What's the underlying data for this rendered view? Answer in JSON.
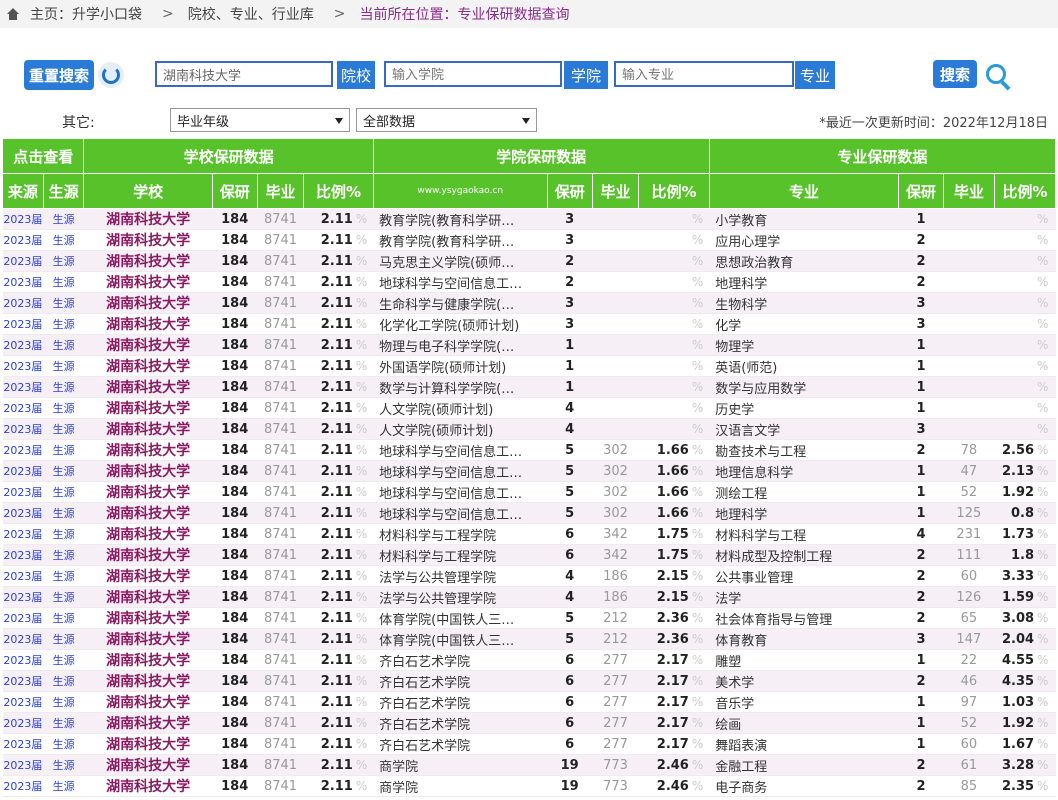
{
  "breadcrumb": {
    "home": "主页：升学小口袋",
    "level2": "院校、专业、行业库",
    "current": "当前所在位置：专业保研数据查询"
  },
  "search": {
    "reset_label": "重置搜索",
    "school_value": "湖南科技大学",
    "school_label": "院校",
    "college_placeholder": "输入学院",
    "college_label": "学院",
    "major_placeholder": "输入专业",
    "major_label": "专业",
    "search_label": "搜索"
  },
  "filters": {
    "label": "其它:",
    "year_select": "毕业年级",
    "data_select": "全部数据",
    "updated": "*最近一次更新时间：2022年12月18日"
  },
  "table": {
    "group_headers": {
      "click": "点击查看",
      "school": "学校保研数据",
      "college": "学院保研数据",
      "major": "专业保研数据"
    },
    "headers": {
      "source": "来源",
      "origin": "生源",
      "school": "学校",
      "baoyan": "保研",
      "grad": "毕业",
      "ratio": "比例%",
      "watermark": "www.ysygaokao.cn",
      "c_baoyan": "保研",
      "c_grad": "毕业",
      "c_ratio": "比例%",
      "major": "专业",
      "m_baoyan": "保研",
      "m_grad": "毕业",
      "m_ratio": "比例%"
    },
    "pct_sign": "%",
    "rows": [
      {
        "src": "2023届",
        "gen": "生源",
        "school": "湖南科技大学",
        "sb": "184",
        "sg": "8741",
        "sr": "2.11",
        "college": "教育学院(教育科学研…",
        "cb": "3",
        "cg": "",
        "cr": "",
        "major": "小学教育",
        "mb": "1",
        "mg": "",
        "mr": ""
      },
      {
        "src": "2023届",
        "gen": "生源",
        "school": "湖南科技大学",
        "sb": "184",
        "sg": "8741",
        "sr": "2.11",
        "college": "教育学院(教育科学研…",
        "cb": "3",
        "cg": "",
        "cr": "",
        "major": "应用心理学",
        "mb": "2",
        "mg": "",
        "mr": ""
      },
      {
        "src": "2023届",
        "gen": "生源",
        "school": "湖南科技大学",
        "sb": "184",
        "sg": "8741",
        "sr": "2.11",
        "college": "马克思主义学院(硕师…",
        "cb": "2",
        "cg": "",
        "cr": "",
        "major": "思想政治教育",
        "mb": "2",
        "mg": "",
        "mr": ""
      },
      {
        "src": "2023届",
        "gen": "生源",
        "school": "湖南科技大学",
        "sb": "184",
        "sg": "8741",
        "sr": "2.11",
        "college": "地球科学与空间信息工…",
        "cb": "2",
        "cg": "",
        "cr": "",
        "major": "地理科学",
        "mb": "2",
        "mg": "",
        "mr": ""
      },
      {
        "src": "2023届",
        "gen": "生源",
        "school": "湖南科技大学",
        "sb": "184",
        "sg": "8741",
        "sr": "2.11",
        "college": "生命科学与健康学院(…",
        "cb": "3",
        "cg": "",
        "cr": "",
        "major": "生物科学",
        "mb": "3",
        "mg": "",
        "mr": ""
      },
      {
        "src": "2023届",
        "gen": "生源",
        "school": "湖南科技大学",
        "sb": "184",
        "sg": "8741",
        "sr": "2.11",
        "college": "化学化工学院(硕师计划)",
        "cb": "3",
        "cg": "",
        "cr": "",
        "major": "化学",
        "mb": "3",
        "mg": "",
        "mr": ""
      },
      {
        "src": "2023届",
        "gen": "生源",
        "school": "湖南科技大学",
        "sb": "184",
        "sg": "8741",
        "sr": "2.11",
        "college": "物理与电子科学学院(…",
        "cb": "1",
        "cg": "",
        "cr": "",
        "major": "物理学",
        "mb": "1",
        "mg": "",
        "mr": ""
      },
      {
        "src": "2023届",
        "gen": "生源",
        "school": "湖南科技大学",
        "sb": "184",
        "sg": "8741",
        "sr": "2.11",
        "college": "外国语学院(硕师计划)",
        "cb": "1",
        "cg": "",
        "cr": "",
        "major": "英语(师范)",
        "mb": "1",
        "mg": "",
        "mr": ""
      },
      {
        "src": "2023届",
        "gen": "生源",
        "school": "湖南科技大学",
        "sb": "184",
        "sg": "8741",
        "sr": "2.11",
        "college": "数学与计算科学学院(…",
        "cb": "1",
        "cg": "",
        "cr": "",
        "major": "数学与应用数学",
        "mb": "1",
        "mg": "",
        "mr": ""
      },
      {
        "src": "2023届",
        "gen": "生源",
        "school": "湖南科技大学",
        "sb": "184",
        "sg": "8741",
        "sr": "2.11",
        "college": "人文学院(硕师计划)",
        "cb": "4",
        "cg": "",
        "cr": "",
        "major": "历史学",
        "mb": "1",
        "mg": "",
        "mr": ""
      },
      {
        "src": "2023届",
        "gen": "生源",
        "school": "湖南科技大学",
        "sb": "184",
        "sg": "8741",
        "sr": "2.11",
        "college": "人文学院(硕师计划)",
        "cb": "4",
        "cg": "",
        "cr": "",
        "major": "汉语言文学",
        "mb": "3",
        "mg": "",
        "mr": ""
      },
      {
        "src": "2023届",
        "gen": "生源",
        "school": "湖南科技大学",
        "sb": "184",
        "sg": "8741",
        "sr": "2.11",
        "college": "地球科学与空间信息工…",
        "cb": "5",
        "cg": "302",
        "cr": "1.66",
        "major": "勘查技术与工程",
        "mb": "2",
        "mg": "78",
        "mr": "2.56"
      },
      {
        "src": "2023届",
        "gen": "生源",
        "school": "湖南科技大学",
        "sb": "184",
        "sg": "8741",
        "sr": "2.11",
        "college": "地球科学与空间信息工…",
        "cb": "5",
        "cg": "302",
        "cr": "1.66",
        "major": "地理信息科学",
        "mb": "1",
        "mg": "47",
        "mr": "2.13"
      },
      {
        "src": "2023届",
        "gen": "生源",
        "school": "湖南科技大学",
        "sb": "184",
        "sg": "8741",
        "sr": "2.11",
        "college": "地球科学与空间信息工…",
        "cb": "5",
        "cg": "302",
        "cr": "1.66",
        "major": "测绘工程",
        "mb": "1",
        "mg": "52",
        "mr": "1.92"
      },
      {
        "src": "2023届",
        "gen": "生源",
        "school": "湖南科技大学",
        "sb": "184",
        "sg": "8741",
        "sr": "2.11",
        "college": "地球科学与空间信息工…",
        "cb": "5",
        "cg": "302",
        "cr": "1.66",
        "major": "地理科学",
        "mb": "1",
        "mg": "125",
        "mr": "0.8"
      },
      {
        "src": "2023届",
        "gen": "生源",
        "school": "湖南科技大学",
        "sb": "184",
        "sg": "8741",
        "sr": "2.11",
        "college": "材料科学与工程学院",
        "cb": "6",
        "cg": "342",
        "cr": "1.75",
        "major": "材料科学与工程",
        "mb": "4",
        "mg": "231",
        "mr": "1.73"
      },
      {
        "src": "2023届",
        "gen": "生源",
        "school": "湖南科技大学",
        "sb": "184",
        "sg": "8741",
        "sr": "2.11",
        "college": "材料科学与工程学院",
        "cb": "6",
        "cg": "342",
        "cr": "1.75",
        "major": "材料成型及控制工程",
        "mb": "2",
        "mg": "111",
        "mr": "1.8"
      },
      {
        "src": "2023届",
        "gen": "生源",
        "school": "湖南科技大学",
        "sb": "184",
        "sg": "8741",
        "sr": "2.11",
        "college": "法学与公共管理学院",
        "cb": "4",
        "cg": "186",
        "cr": "2.15",
        "major": "公共事业管理",
        "mb": "2",
        "mg": "60",
        "mr": "3.33"
      },
      {
        "src": "2023届",
        "gen": "生源",
        "school": "湖南科技大学",
        "sb": "184",
        "sg": "8741",
        "sr": "2.11",
        "college": "法学与公共管理学院",
        "cb": "4",
        "cg": "186",
        "cr": "2.15",
        "major": "法学",
        "mb": "2",
        "mg": "126",
        "mr": "1.59"
      },
      {
        "src": "2023届",
        "gen": "生源",
        "school": "湖南科技大学",
        "sb": "184",
        "sg": "8741",
        "sr": "2.11",
        "college": "体育学院(中国铁人三…",
        "cb": "5",
        "cg": "212",
        "cr": "2.36",
        "major": "社会体育指导与管理",
        "mb": "2",
        "mg": "65",
        "mr": "3.08"
      },
      {
        "src": "2023届",
        "gen": "生源",
        "school": "湖南科技大学",
        "sb": "184",
        "sg": "8741",
        "sr": "2.11",
        "college": "体育学院(中国铁人三…",
        "cb": "5",
        "cg": "212",
        "cr": "2.36",
        "major": "体育教育",
        "mb": "3",
        "mg": "147",
        "mr": "2.04"
      },
      {
        "src": "2023届",
        "gen": "生源",
        "school": "湖南科技大学",
        "sb": "184",
        "sg": "8741",
        "sr": "2.11",
        "college": "齐白石艺术学院",
        "cb": "6",
        "cg": "277",
        "cr": "2.17",
        "major": "雕塑",
        "mb": "1",
        "mg": "22",
        "mr": "4.55"
      },
      {
        "src": "2023届",
        "gen": "生源",
        "school": "湖南科技大学",
        "sb": "184",
        "sg": "8741",
        "sr": "2.11",
        "college": "齐白石艺术学院",
        "cb": "6",
        "cg": "277",
        "cr": "2.17",
        "major": "美术学",
        "mb": "2",
        "mg": "46",
        "mr": "4.35"
      },
      {
        "src": "2023届",
        "gen": "生源",
        "school": "湖南科技大学",
        "sb": "184",
        "sg": "8741",
        "sr": "2.11",
        "college": "齐白石艺术学院",
        "cb": "6",
        "cg": "277",
        "cr": "2.17",
        "major": "音乐学",
        "mb": "1",
        "mg": "97",
        "mr": "1.03"
      },
      {
        "src": "2023届",
        "gen": "生源",
        "school": "湖南科技大学",
        "sb": "184",
        "sg": "8741",
        "sr": "2.11",
        "college": "齐白石艺术学院",
        "cb": "6",
        "cg": "277",
        "cr": "2.17",
        "major": "绘画",
        "mb": "1",
        "mg": "52",
        "mr": "1.92"
      },
      {
        "src": "2023届",
        "gen": "生源",
        "school": "湖南科技大学",
        "sb": "184",
        "sg": "8741",
        "sr": "2.11",
        "college": "齐白石艺术学院",
        "cb": "6",
        "cg": "277",
        "cr": "2.17",
        "major": "舞蹈表演",
        "mb": "1",
        "mg": "60",
        "mr": "1.67"
      },
      {
        "src": "2023届",
        "gen": "生源",
        "school": "湖南科技大学",
        "sb": "184",
        "sg": "8741",
        "sr": "2.11",
        "college": "商学院",
        "cb": "19",
        "cg": "773",
        "cr": "2.46",
        "major": "金融工程",
        "mb": "2",
        "mg": "61",
        "mr": "3.28"
      },
      {
        "src": "2023届",
        "gen": "生源",
        "school": "湖南科技大学",
        "sb": "184",
        "sg": "8741",
        "sr": "2.11",
        "college": "商学院",
        "cb": "19",
        "cg": "773",
        "cr": "2.46",
        "major": "电子商务",
        "mb": "2",
        "mg": "85",
        "mr": "2.35"
      }
    ]
  }
}
